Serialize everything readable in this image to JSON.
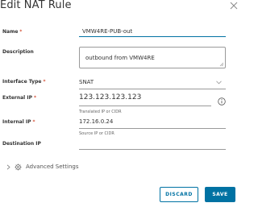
{
  "dialog": {
    "title": "Edit NAT Rule",
    "close_icon": "close-icon"
  },
  "form": {
    "name": {
      "label": "Name",
      "required_mark": "*",
      "value": "VMW4RE-PUB-out"
    },
    "description": {
      "label": "Description",
      "value": "outbound from VMW4RE"
    },
    "interface_type": {
      "label": "Interface Type",
      "required_mark": "*",
      "value": "SNAT",
      "icon": "chevron-down-icon"
    },
    "external_ip": {
      "label": "External IP",
      "required_mark": "*",
      "value": "123.123.123.123",
      "helper": "Translated IP or CIDR",
      "icon": "info-icon"
    },
    "internal_ip": {
      "label": "Internal IP",
      "required_mark": "*",
      "value": "172.16.0.24",
      "helper": "Source IP or CIDR"
    },
    "destination_ip": {
      "label": "Destination IP",
      "value": ""
    }
  },
  "advanced": {
    "label": "Advanced Settings",
    "icons": [
      "chevron-right-icon",
      "gear-icon"
    ]
  },
  "buttons": {
    "discard": "DISCARD",
    "save": "SAVE"
  },
  "colors": {
    "primary": "#0072a3",
    "required": "#c92100",
    "text": "#333333",
    "line": "#9a9a9a"
  }
}
